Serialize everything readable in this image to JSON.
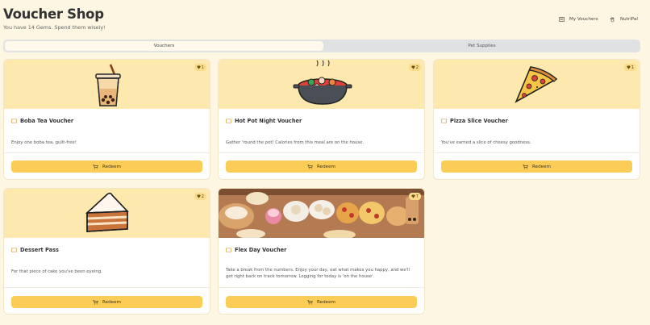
{
  "header": {
    "title": "Voucher Shop",
    "subtitle": "You have 14 Gems. Spend them wisely!",
    "nav_my_vouchers": "My Vouchers",
    "nav_nutripal": "NutriPal"
  },
  "tabs": [
    {
      "label": "Vouchers",
      "active": true
    },
    {
      "label": "Pet Supplies",
      "active": false
    }
  ],
  "colors": {
    "page_bg": "#fdf6e3",
    "card_image_bg": "#fde8ad",
    "button": "#fbcd58",
    "badge": "#fbdc8c"
  },
  "vouchers": [
    {
      "title": "Boba Tea Voucher",
      "cost": "1",
      "description": "Enjoy one boba tea, guilt-free!",
      "button": "Redeem",
      "image": "boba-tea-image",
      "icon": "ticket-icon"
    },
    {
      "title": "Hot Pot Night Voucher",
      "cost": "2",
      "description": "Gather 'round the pot! Calories from this meal are on the house.",
      "button": "Redeem",
      "image": "hot-pot-image",
      "icon": "ticket-icon"
    },
    {
      "title": "Pizza Slice Voucher",
      "cost": "1",
      "description": "You've earned a slice of cheesy goodness.",
      "button": "Redeem",
      "image": "pizza-slice-image",
      "icon": "ticket-icon"
    },
    {
      "title": "Dessert Pass",
      "cost": "2",
      "description": "For that piece of cake you've been eyeing.",
      "button": "Redeem",
      "image": "cake-slice-image",
      "icon": "ticket-icon"
    },
    {
      "title": "Flex Day Voucher",
      "cost": "7",
      "description": "Take a break from the numbers. Enjoy your day, eat what makes you happy, and we'll get right back on track tomorrow. Logging for today is 'on the house'.",
      "button": "Redeem",
      "image": "food-feast-image",
      "icon": "ticket-icon"
    }
  ]
}
